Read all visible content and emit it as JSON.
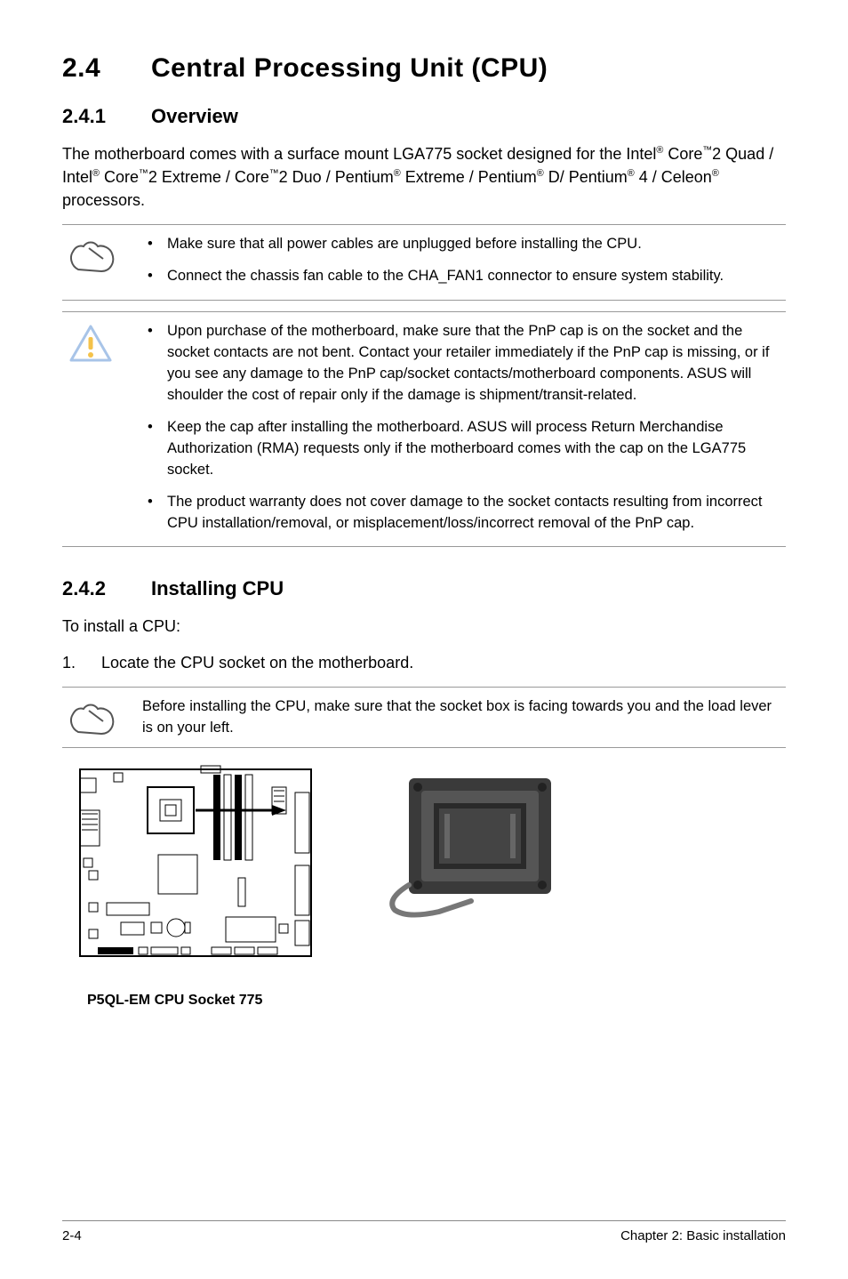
{
  "section": {
    "number": "2.4",
    "title": "Central Processing Unit (CPU)"
  },
  "sub1": {
    "number": "2.4.1",
    "title": "Overview",
    "intro_parts": {
      "p1": "The motherboard comes with a surface mount LGA775 socket designed for the Intel",
      "p2": " Core",
      "p3": "2 Quad / Intel",
      "p4": " Core",
      "p5": "2 Extreme / Core",
      "p6": "2 Duo / Pentium",
      "p7": " Extreme / Pentium",
      "p8": " D/ Pentium",
      "p9": " 4 / Celeon",
      "p10": " processors."
    },
    "reg": "®",
    "tm": "™"
  },
  "note1": {
    "items": [
      "Make sure that all power cables are unplugged before installing the CPU.",
      "Connect the chassis fan cable to the CHA_FAN1 connector to ensure system stability."
    ]
  },
  "note2": {
    "items": [
      "Upon purchase of the motherboard, make sure that the PnP cap is on the socket and the socket contacts are not bent. Contact your retailer immediately if the PnP cap is missing, or if you see any damage to the PnP cap/socket contacts/motherboard components. ASUS will shoulder the cost of repair only if the damage is shipment/transit-related.",
      "Keep the cap after installing the motherboard. ASUS will process Return Merchandise Authorization (RMA) requests only if the motherboard comes with the cap on the LGA775 socket.",
      "The product warranty does not cover damage to the socket contacts resulting from incorrect CPU installation/removal, or misplacement/loss/incorrect removal of the PnP cap."
    ]
  },
  "sub2": {
    "number": "2.4.2",
    "title": "Installing CPU",
    "lead": "To install a CPU:",
    "step1_num": "1.",
    "step1_text": "Locate the CPU socket on the motherboard."
  },
  "note3": {
    "text": "Before installing the CPU, make sure that the socket box is facing towards you and the load lever is on your left."
  },
  "diagram_caption": "P5QL-EM CPU Socket 775",
  "footer": {
    "page": "2-4",
    "chapter": "Chapter 2: Basic installation"
  }
}
